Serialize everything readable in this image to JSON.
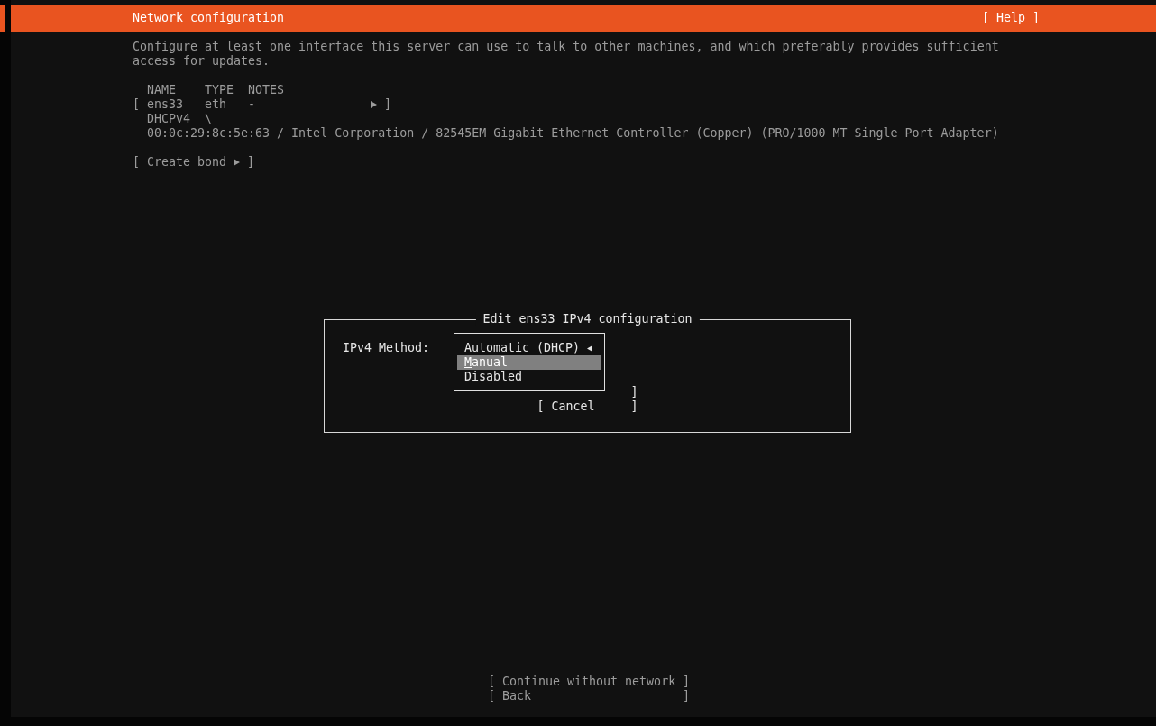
{
  "header": {
    "title": "Network configuration",
    "help": "[ Help ]"
  },
  "intro": "Configure at least one interface this server can use to talk to other machines, and which preferably provides sufficient access for updates.",
  "table": {
    "columns": [
      "NAME",
      "TYPE",
      "NOTES"
    ],
    "interfaces": [
      {
        "open": "[",
        "name": "ens33",
        "type": "eth",
        "notes": "-",
        "close": "]",
        "method": "DHCPv4",
        "method_status": "\\",
        "hardware": "00:0c:29:8c:5e:63 / Intel Corporation / 82545EM Gigabit Ethernet Controller (Copper) (PRO/1000 MT Single Port Adapter)"
      }
    ]
  },
  "create_bond": {
    "open": "[",
    "label": "Create bond",
    "close": "]"
  },
  "dialog": {
    "title": "Edit ens33 IPv4 configuration",
    "field_label": "IPv4 Method:",
    "options": [
      {
        "label": "Automatic (DHCP)",
        "current": true,
        "selected": false
      },
      {
        "label": "Manual",
        "current": false,
        "selected": true
      },
      {
        "label": "Disabled",
        "current": false,
        "selected": false
      }
    ],
    "buttons": [
      {
        "kind": "covered",
        "close": "]"
      },
      {
        "kind": "full",
        "label": "[ Cancel",
        "close": "]"
      }
    ]
  },
  "footer_buttons": [
    {
      "label": "[ Continue without network",
      "close": "]"
    },
    {
      "label": "[ Back",
      "close": "]"
    }
  ]
}
